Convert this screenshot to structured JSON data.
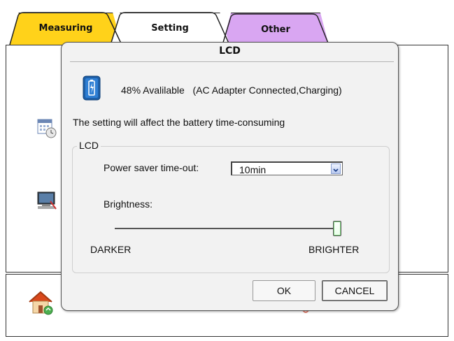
{
  "tabs": [
    {
      "label": "Measuring",
      "color": "#ffd21a"
    },
    {
      "label": "Setting",
      "color": "#ffffff"
    },
    {
      "label": "Other",
      "color": "#d9a6f2"
    }
  ],
  "background_icons": [
    "calendar-clock-icon",
    "monitor-tools-icon",
    "home-icon"
  ],
  "dialog": {
    "title": "LCD",
    "battery": {
      "icon": "battery-charging-icon",
      "status": "48% Avalilable   (AC Adapter Connected,Charging)"
    },
    "note": "The setting will affect the battery time-consuming",
    "group": {
      "title": "LCD",
      "timeout_label": "Power saver time-out:",
      "timeout_value": "10min",
      "brightness_label": "Brightness:",
      "brightness_level": 1.0,
      "min_label": "DARKER",
      "max_label": "BRIGHTER"
    },
    "ok_label": "OK",
    "cancel_label": "CANCEL"
  }
}
